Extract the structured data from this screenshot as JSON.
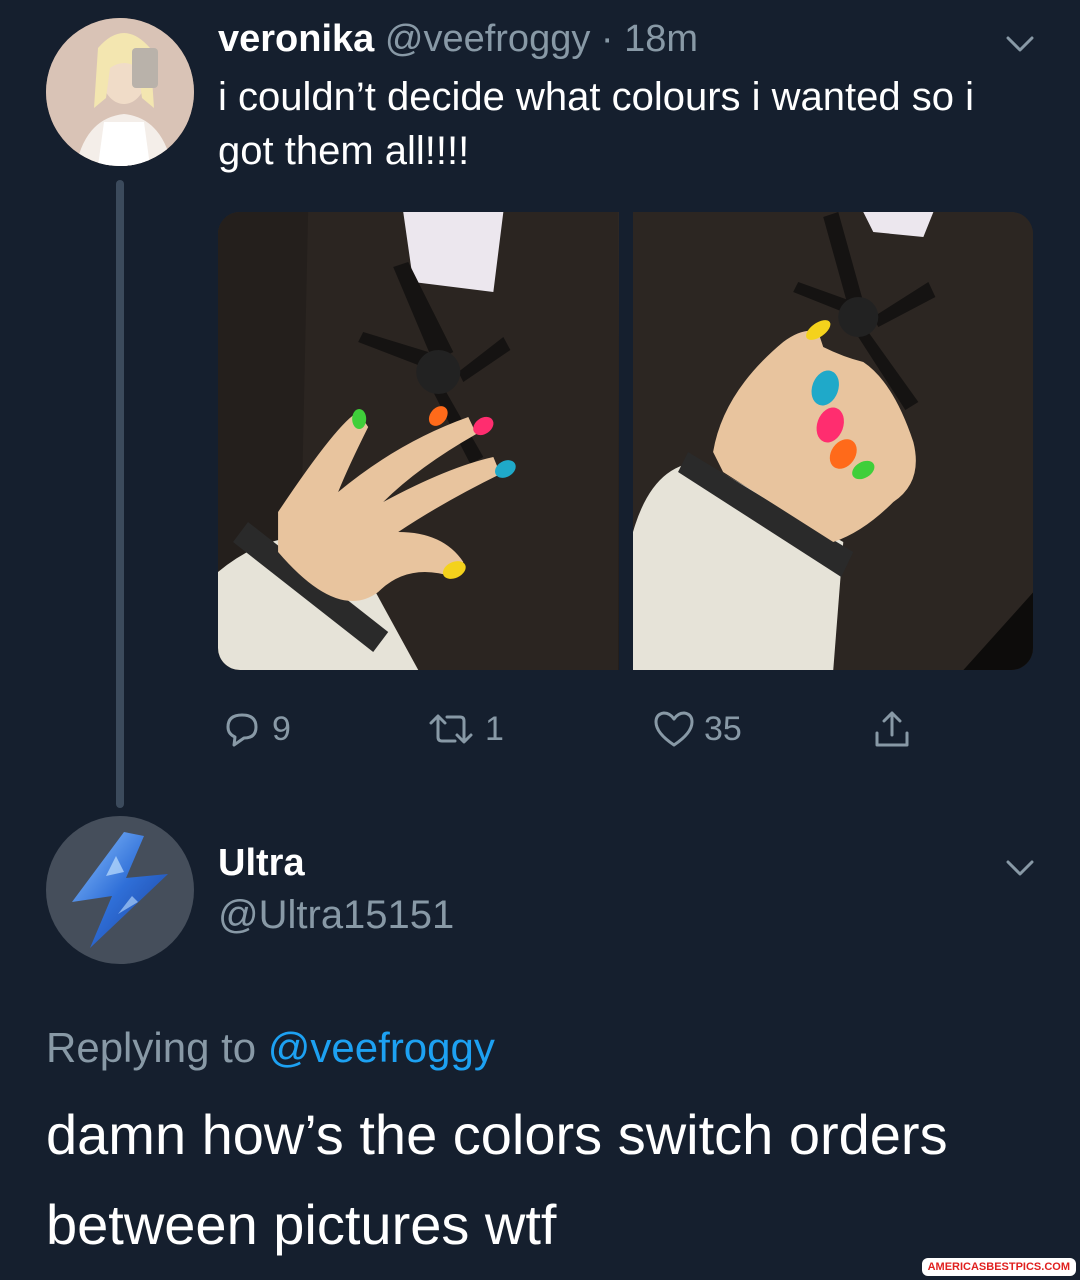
{
  "tweet1": {
    "display_name": "veronika",
    "handle": "@veefroggy",
    "separator": "·",
    "time": "18m",
    "text": "i couldn’t decide what colours i wanted so i got them all!!!!",
    "avatar_icon": "profile-photo",
    "photos": [
      "nails-photo-left",
      "nails-photo-right"
    ],
    "actions": {
      "reply_count": "9",
      "retweet_count": "1",
      "like_count": "35"
    }
  },
  "tweet2": {
    "display_name": "Ultra",
    "handle": "@Ultra15151",
    "avatar_icon": "lightning-bolt-icon",
    "replying_prefix": "Replying to",
    "replying_handle": "@veefroggy",
    "text": "damn how’s the colors switch orders between pictures wtf"
  },
  "watermark": "AMERICASBESTPICS.COM",
  "colors": {
    "background": "#151f2e",
    "secondary_text": "#8899a6",
    "link": "#1da1f2",
    "thread_line": "#3b4a5c"
  }
}
